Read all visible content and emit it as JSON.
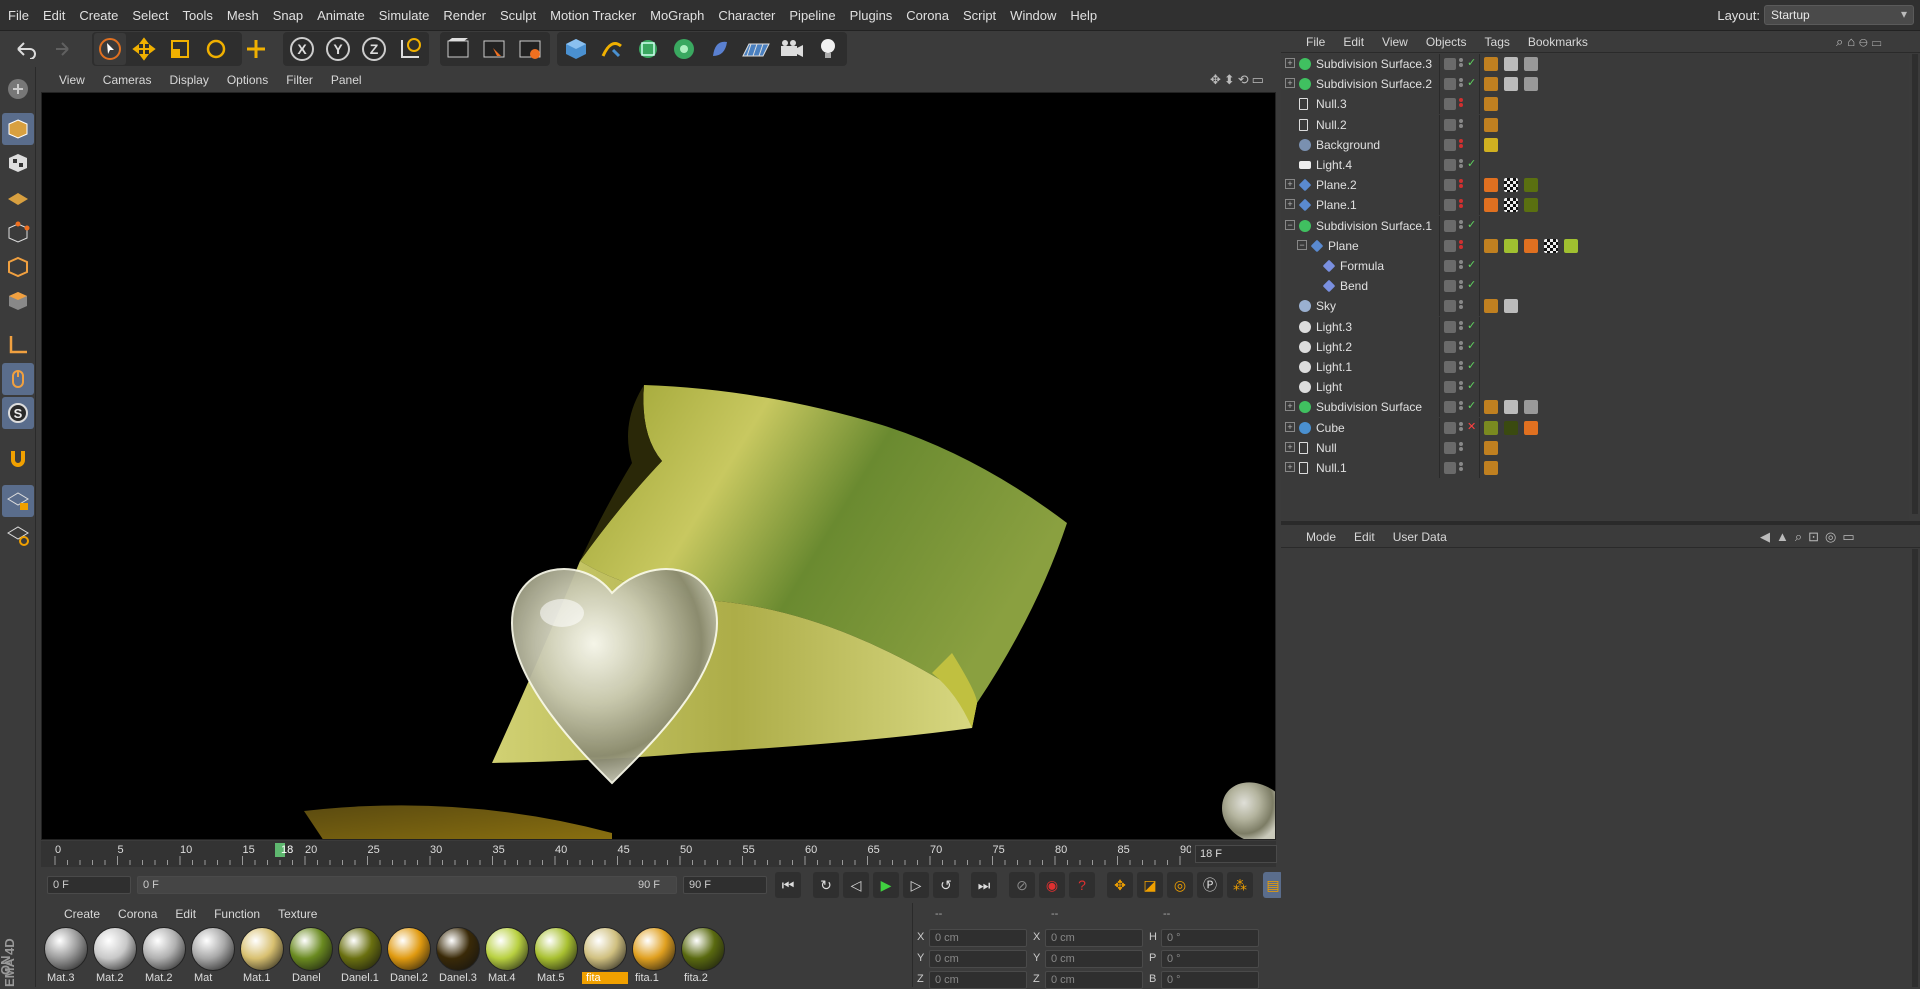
{
  "menubar": {
    "items": [
      "File",
      "Edit",
      "Create",
      "Select",
      "Tools",
      "Mesh",
      "Snap",
      "Animate",
      "Simulate",
      "Render",
      "Sculpt",
      "Motion Tracker",
      "MoGraph",
      "Character",
      "Pipeline",
      "Plugins",
      "Corona",
      "Script",
      "Window",
      "Help"
    ],
    "layout_label": "Layout:",
    "layout_value": "Startup"
  },
  "viewport_menu": [
    "View",
    "Cameras",
    "Display",
    "Options",
    "Filter",
    "Panel"
  ],
  "timeline": {
    "ticks": [
      "0",
      "5",
      "10",
      "15",
      "20",
      "25",
      "30",
      "35",
      "40",
      "45",
      "50",
      "55",
      "60",
      "65",
      "70",
      "75",
      "80",
      "85",
      "90"
    ],
    "current_frame_marker": "18",
    "current_frame_display": "18 F",
    "start_field": "0 F",
    "range_start": "0 F",
    "range_end": "90 F",
    "end_field": "90 F"
  },
  "material_menu": [
    "Create",
    "Corona",
    "Edit",
    "Function",
    "Texture"
  ],
  "materials": [
    {
      "label": "Mat.3",
      "color": "#9a9a9a"
    },
    {
      "label": "Mat.2",
      "color": "#c8c8c8"
    },
    {
      "label": "Mat.2",
      "color": "#b0b0b0"
    },
    {
      "label": "Mat",
      "color": "#a8a8a8"
    },
    {
      "label": "Mat.1",
      "color": "#d8c070"
    },
    {
      "label": "Danel",
      "color": "#6a8a20"
    },
    {
      "label": "Danel.1",
      "color": "#6a7010"
    },
    {
      "label": "Danel.2",
      "color": "#e09a10"
    },
    {
      "label": "Danel.3",
      "color": "#3a2a08"
    },
    {
      "label": "Mat.4",
      "color": "#b8d040"
    },
    {
      "label": "Mat.5",
      "color": "#a8c030"
    },
    {
      "label": "fita",
      "color": "#d0c080"
    },
    {
      "label": "fita.1",
      "color": "#e0a020"
    },
    {
      "label": "fita.2",
      "color": "#5a6a10"
    }
  ],
  "coords": {
    "header": [
      "--",
      "--",
      "--"
    ],
    "rows": [
      {
        "a_label": "X",
        "a_val": "0 cm",
        "b_label": "X",
        "b_val": "0 cm",
        "c_label": "H",
        "c_val": "0 °"
      },
      {
        "a_label": "Y",
        "a_val": "0 cm",
        "b_label": "Y",
        "b_val": "0 cm",
        "c_label": "P",
        "c_val": "0 °"
      },
      {
        "a_label": "Z",
        "a_val": "0 cm",
        "b_label": "Z",
        "b_val": "0 cm",
        "c_label": "B",
        "c_val": "0 °"
      }
    ]
  },
  "object_manager_menu": [
    "File",
    "Edit",
    "View",
    "Objects",
    "Tags",
    "Bookmarks"
  ],
  "objects": [
    {
      "name": "Subdivision Surface.3",
      "icon": "subdivision-icon",
      "indent": 0,
      "expand": true,
      "check": true
    },
    {
      "name": "Subdivision Surface.2",
      "icon": "subdivision-icon",
      "indent": 0,
      "expand": true,
      "check": true
    },
    {
      "name": "Null.3",
      "icon": "null-icon",
      "indent": 0,
      "expand": false,
      "check": false
    },
    {
      "name": "Null.2",
      "icon": "null-icon",
      "indent": 0,
      "expand": false,
      "check": false
    },
    {
      "name": "Background",
      "icon": "background-icon",
      "indent": 0,
      "expand": false,
      "check": false
    },
    {
      "name": "Light.4",
      "icon": "area-light-icon",
      "indent": 0,
      "expand": false,
      "check": true
    },
    {
      "name": "Plane.2",
      "icon": "plane-icon",
      "indent": 0,
      "expand": true,
      "check": false
    },
    {
      "name": "Plane.1",
      "icon": "plane-icon",
      "indent": 0,
      "expand": true,
      "check": false
    },
    {
      "name": "Subdivision Surface.1",
      "icon": "subdivision-icon",
      "indent": 0,
      "expand": true,
      "check": true
    },
    {
      "name": "Plane",
      "icon": "plane-icon",
      "indent": 1,
      "expand": true,
      "check": false
    },
    {
      "name": "Formula",
      "icon": "deformer-icon",
      "indent": 2,
      "expand": false,
      "check": true
    },
    {
      "name": "Bend",
      "icon": "deformer-icon",
      "indent": 2,
      "expand": false,
      "check": true
    },
    {
      "name": "Sky",
      "icon": "sky-icon",
      "indent": 0,
      "expand": false,
      "check": false
    },
    {
      "name": "Light.3",
      "icon": "light-icon",
      "indent": 0,
      "expand": false,
      "check": true
    },
    {
      "name": "Light.2",
      "icon": "light-icon",
      "indent": 0,
      "expand": false,
      "check": true
    },
    {
      "name": "Light.1",
      "icon": "light-icon",
      "indent": 0,
      "expand": false,
      "check": true
    },
    {
      "name": "Light",
      "icon": "light-icon",
      "indent": 0,
      "expand": false,
      "check": true
    },
    {
      "name": "Subdivision Surface",
      "icon": "subdivision-icon",
      "indent": 0,
      "expand": true,
      "check": true
    },
    {
      "name": "Cube",
      "icon": "cube-icon",
      "indent": 0,
      "expand": true,
      "check": false,
      "cross": true
    },
    {
      "name": "Null",
      "icon": "null-icon",
      "indent": 0,
      "expand": true,
      "check": false
    },
    {
      "name": "Null.1",
      "icon": "null-icon",
      "indent": 0,
      "expand": true,
      "check": false
    }
  ],
  "attribute_manager_menu": [
    "Mode",
    "Edit",
    "User Data"
  ],
  "side_label": "EMA 4D",
  "side_label2": "ON"
}
